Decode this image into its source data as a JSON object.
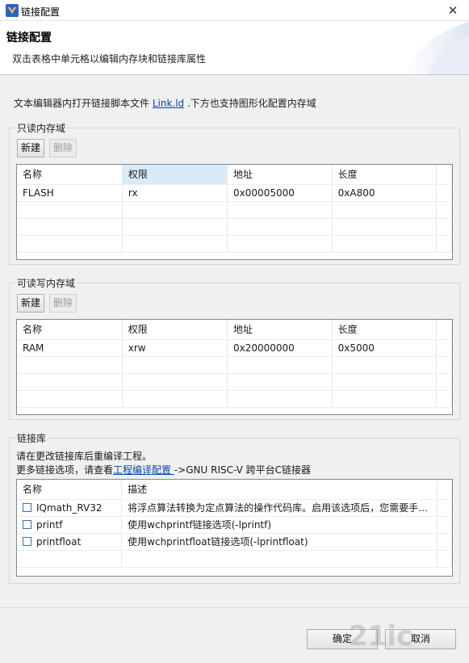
{
  "window": {
    "title": "链接配置",
    "close_glyph": "✕"
  },
  "header": {
    "title": "链接配置",
    "description": "双击表格中单元格以编辑内存块和链接库属性"
  },
  "intro": {
    "prefix": "文本编辑器内打开链接脚本文件 ",
    "link": "Link.ld",
    "suffix": " .下方也支持图形化配置内存域"
  },
  "readonly": {
    "legend": "只读内存域",
    "new_label": "新建",
    "delete_label": "删除",
    "columns": [
      "名称",
      "权限",
      "地址",
      "长度"
    ],
    "rows": [
      [
        "FLASH",
        "rx",
        "0x00005000",
        "0xA800"
      ]
    ]
  },
  "readwrite": {
    "legend": "可读写内存域",
    "new_label": "新建",
    "delete_label": "删除",
    "columns": [
      "名称",
      "权限",
      "地址",
      "长度"
    ],
    "rows": [
      [
        "RAM",
        "xrw",
        "0x20000000",
        "0x5000"
      ]
    ]
  },
  "libs": {
    "legend": "链接库",
    "note1": "请在更改链接库后重编译工程。",
    "note2_prefix": "更多链接选项，请查看",
    "note2_link": "工程编译配置 ",
    "note2_suffix": "->GNU RISC-V 跨平台C链接器",
    "columns": [
      "名称",
      "描述"
    ],
    "rows": [
      {
        "name": "IQmath_RV32",
        "desc": "将浮点算法转换为定点算法的操作代码库。启用该选项后，您需要手…",
        "checked": false
      },
      {
        "name": "printf",
        "desc": "使用wchprintf链接选项(-lprintf)",
        "checked": false
      },
      {
        "name": "printfloat",
        "desc": "使用wchprintfloat链接选项(-lprintfloat)",
        "checked": false
      }
    ]
  },
  "footer": {
    "ok_label": "确定",
    "cancel_label": "取消",
    "watermark": "21ic"
  },
  "colors": {
    "accent": "#0645ad",
    "header_bg": "#ffffff",
    "selected_header": "#d9ebf9"
  }
}
